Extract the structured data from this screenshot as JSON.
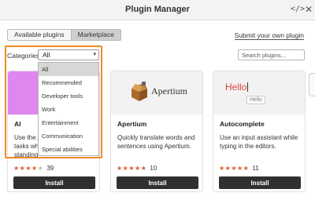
{
  "window": {
    "title": "Plugin Manager",
    "icons": [
      "code-icon",
      "close-icon"
    ]
  },
  "tabs": [
    {
      "label": "Available plugins",
      "active": false
    },
    {
      "label": "Marketplace",
      "active": true
    }
  ],
  "submit_link": "Submit your own plugin",
  "filters": {
    "label": "Categories",
    "selected": "All",
    "options": [
      "All",
      "Recommended",
      "Developer tools",
      "Work",
      "Entertainment",
      "Communication",
      "Special abilities"
    ]
  },
  "search": {
    "placeholder": "Search plugins..."
  },
  "plugins": [
    {
      "name": "AI",
      "desc_lines": [
        "Use the A",
        "tasks wh",
        "standing"
      ],
      "rating": 4,
      "reviews": "39",
      "install_label": "Install"
    },
    {
      "name": "Apertium",
      "logo_text": "Apertium",
      "desc": "Quickly translate words and sentences using Apertium.",
      "rating": 4.5,
      "reviews": "10",
      "install_label": "Install"
    },
    {
      "name": "Autocomplete",
      "thumb_big": "Hello",
      "thumb_small": "Hello",
      "desc": "Use an input assistant while typing in the editors.",
      "rating": 4.5,
      "reviews": "11",
      "install_label": "Install"
    }
  ],
  "colors": {
    "accent_outline": "#f08a24",
    "star": "#e05a2b",
    "install_bg": "#303030",
    "ai_thumb": "#e087ef"
  }
}
